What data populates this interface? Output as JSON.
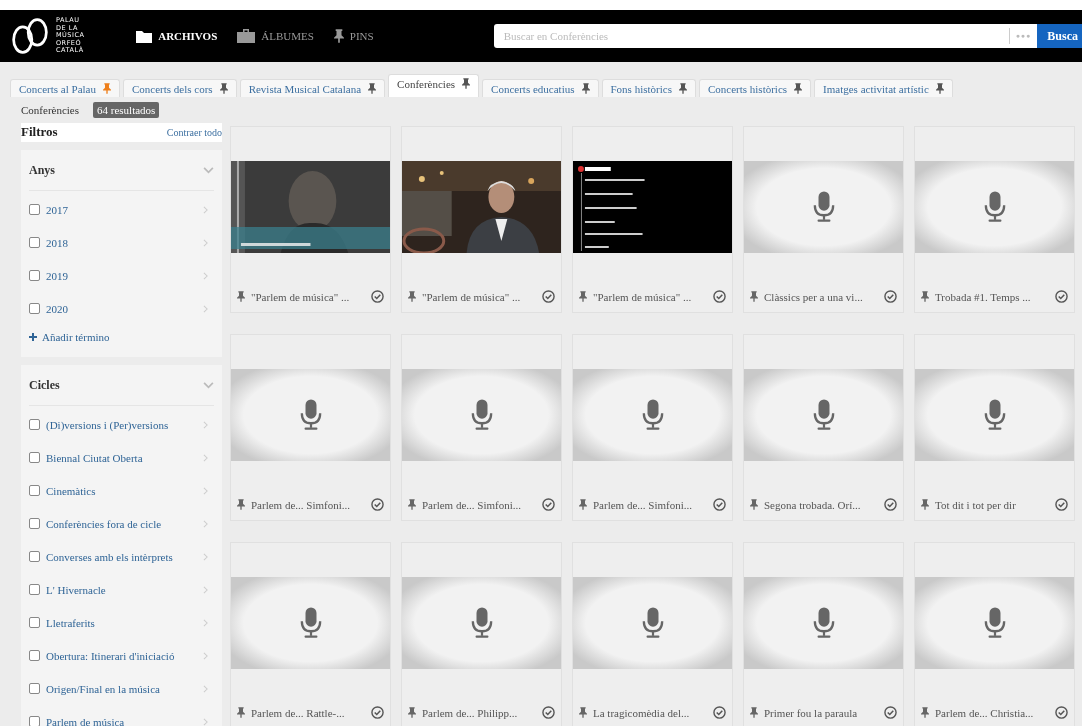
{
  "header": {
    "logo_lines": [
      "PALAU",
      "DE LA",
      "MÚSICA",
      "ORFEÓ",
      "CATALÀ"
    ],
    "nav": [
      {
        "label": "ARCHIVOS",
        "selected": true,
        "kind": "folder"
      },
      {
        "label": "ÁLBUMES",
        "selected": false,
        "kind": "briefcase"
      },
      {
        "label": "PINS",
        "selected": false,
        "kind": "pin"
      }
    ],
    "search": {
      "placeholder": "Buscar en Conferències",
      "options": "●●●",
      "button": "Busca"
    }
  },
  "tabs": [
    {
      "label": "Concerts al Palau",
      "selected": false,
      "pinned": true
    },
    {
      "label": "Concerts dels cors",
      "selected": false,
      "pinned": false
    },
    {
      "label": "Revista Musical Catalana",
      "selected": false,
      "pinned": false
    },
    {
      "label": "Conferències",
      "selected": true,
      "pinned": false
    },
    {
      "label": "Concerts educatius",
      "selected": false,
      "pinned": false
    },
    {
      "label": "Fons històrics",
      "selected": false,
      "pinned": false
    },
    {
      "label": "Concerts històrics",
      "selected": false,
      "pinned": false
    },
    {
      "label": "Imatges activitat artístic",
      "selected": false,
      "pinned": false
    }
  ],
  "breadcrumb": {
    "label": "Conferències",
    "count": "64 resultados"
  },
  "filters": {
    "title": "Filtros",
    "collapse_all": "Contraer todo",
    "sections": [
      {
        "title": "Anys",
        "add_term": "Añadir término",
        "items": [
          {
            "label": "2017",
            "checked": false
          },
          {
            "label": "2018",
            "checked": false
          },
          {
            "label": "2019",
            "checked": false
          },
          {
            "label": "2020",
            "checked": false
          }
        ]
      },
      {
        "title": "Cicles",
        "items": [
          {
            "label": "(Di)versions i (Per)versions",
            "checked": false
          },
          {
            "label": "Biennal Ciutat Oberta",
            "checked": false
          },
          {
            "label": "Cinemàtics",
            "checked": false
          },
          {
            "label": "Conferències fora de cicle",
            "checked": false
          },
          {
            "label": "Converses amb els intèrprets",
            "checked": false
          },
          {
            "label": "L' Hivernacle",
            "checked": false
          },
          {
            "label": "Lletraferits",
            "checked": false
          },
          {
            "label": "Obertura: Itinerari d'iniciació",
            "checked": false
          },
          {
            "label": "Origen/Final en la música",
            "checked": false
          },
          {
            "label": "Parlem de música",
            "checked": false
          }
        ]
      }
    ]
  },
  "results": [
    {
      "title": "\"Parlem de música\" ...",
      "kind": "picture"
    },
    {
      "title": "\"Parlem de música\" ...",
      "kind": "picture"
    },
    {
      "title": "\"Parlem de música\" ...",
      "kind": "picture"
    },
    {
      "title": "Clàssics per a una vi...",
      "kind": "audio"
    },
    {
      "title": "Trobada #1. Temps ...",
      "kind": "audio"
    },
    {
      "title": "Parlem de... Simfoni...",
      "kind": "audio"
    },
    {
      "title": "Parlem de... Simfoni...",
      "kind": "audio"
    },
    {
      "title": "Parlem de... Simfoni...",
      "kind": "audio"
    },
    {
      "title": "Segona trobada. Orí...",
      "kind": "audio"
    },
    {
      "title": "Tot dit i tot per dir",
      "kind": "audio"
    },
    {
      "title": "Parlem de... Rattle-...",
      "kind": "audio"
    },
    {
      "title": "Parlem de... Philipp...",
      "kind": "audio"
    },
    {
      "title": "La tragicomèdia del...",
      "kind": "audio"
    },
    {
      "title": "Primer fou la paraula",
      "kind": "audio"
    },
    {
      "title": "Parlem de... Christia...",
      "kind": "audio"
    }
  ]
}
